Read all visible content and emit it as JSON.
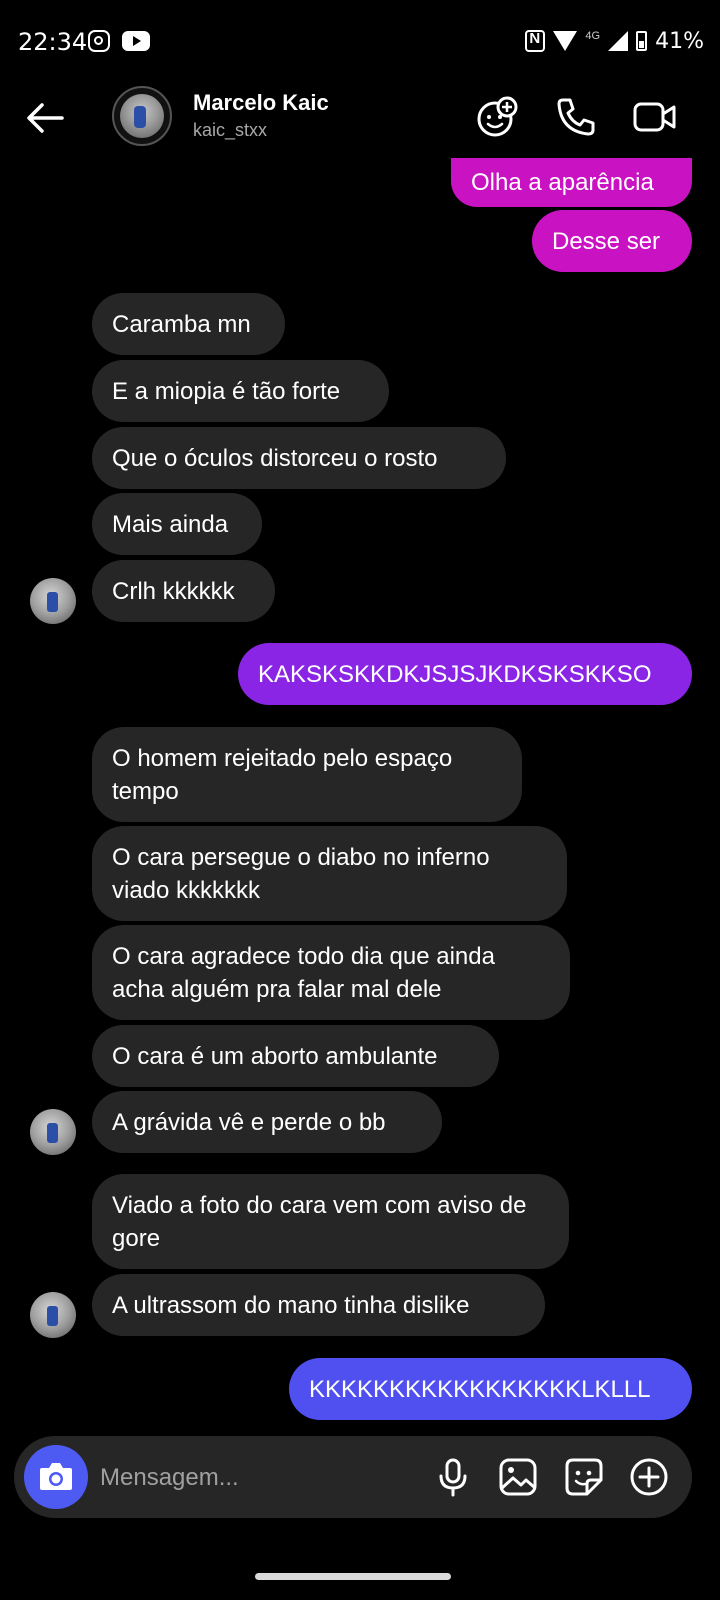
{
  "status_bar": {
    "time": "22:34",
    "network": "4G",
    "battery": "41%"
  },
  "header": {
    "name": "Marcelo Kaic",
    "username": "kaic_stxx"
  },
  "messages": [
    {
      "dir": "out",
      "text": "Olha a aparência",
      "color": "#c913c2"
    },
    {
      "dir": "out",
      "text": "Desse ser",
      "color": "#c913c2"
    },
    {
      "dir": "in",
      "text": "Caramba mn"
    },
    {
      "dir": "in",
      "text": "E a miopia é tão forte"
    },
    {
      "dir": "in",
      "text": "Que o óculos distorceu o rosto"
    },
    {
      "dir": "in",
      "text": "Mais ainda"
    },
    {
      "dir": "in",
      "text": "Crlh kkkkkk"
    },
    {
      "dir": "out",
      "text": "KAKSKSKKDKJSJSJKDKSKSKKSO",
      "color": "#8a25e6"
    },
    {
      "dir": "in",
      "text": "O homem rejeitado pelo espaço tempo"
    },
    {
      "dir": "in",
      "text": "O cara persegue o diabo no inferno viado kkkkkkk"
    },
    {
      "dir": "in",
      "text": "O cara agradece todo dia que ainda acha alguém pra falar mal dele"
    },
    {
      "dir": "in",
      "text": "O cara é um aborto ambulante"
    },
    {
      "dir": "in",
      "text": "A grávida vê e perde o bb"
    },
    {
      "dir": "in",
      "text": "Viado a foto do cara vem com aviso de gore"
    },
    {
      "dir": "in",
      "text": "A ultrassom do mano tinha dislike"
    },
    {
      "dir": "out",
      "text": "KKKKKKKKKKKKKKKKKLKLLL",
      "color": "#5050f0"
    }
  ],
  "composer": {
    "placeholder": "Mensagem..."
  }
}
